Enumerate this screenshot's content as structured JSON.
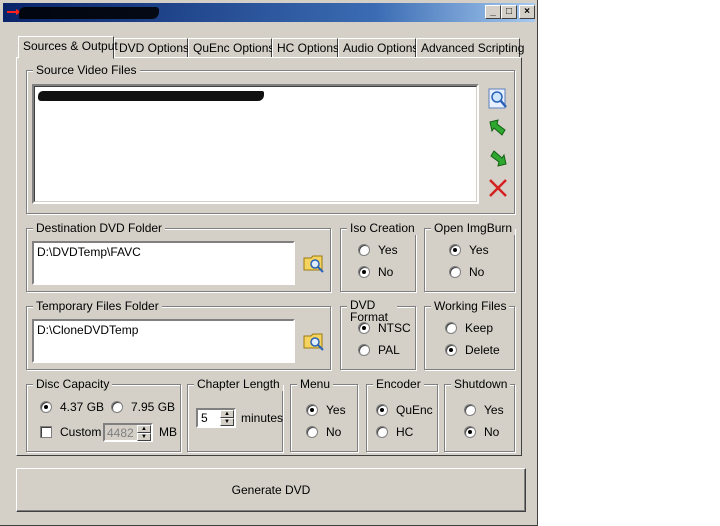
{
  "window": {
    "title": "",
    "controls": {
      "minimize": "_",
      "maximize": "□",
      "close": "×"
    }
  },
  "tabs": [
    {
      "label": "Sources & Output"
    },
    {
      "label": "DVD Options"
    },
    {
      "label": "QuEnc Options"
    },
    {
      "label": "HC Options"
    },
    {
      "label": "Audio Options"
    },
    {
      "label": "Advanced Scripting"
    }
  ],
  "source_video": {
    "legend": "Source Video Files",
    "icons": [
      "browse-icon",
      "move-up-icon",
      "move-down-icon",
      "remove-icon"
    ]
  },
  "destination": {
    "legend": "Destination DVD Folder",
    "value": "D:\\DVDTemp\\FAVC"
  },
  "iso_creation": {
    "legend": "Iso Creation",
    "yes": "Yes",
    "no": "No",
    "selected": "No"
  },
  "open_imgburn": {
    "legend": "Open ImgBurn",
    "yes": "Yes",
    "no": "No",
    "selected": "Yes"
  },
  "temp_folder": {
    "legend": "Temporary Files Folder",
    "value": "D:\\CloneDVDTemp"
  },
  "dvd_format": {
    "legend": "DVD Format",
    "ntsc": "NTSC",
    "pal": "PAL",
    "selected": "NTSC"
  },
  "working_files": {
    "legend": "Working Files",
    "keep": "Keep",
    "delete": "Delete",
    "selected": "Delete"
  },
  "disc_capacity": {
    "legend": "Disc Capacity",
    "opt1": "4.37 GB",
    "opt2": "7.95 GB",
    "selected": "4.37 GB",
    "custom_label": "Custom",
    "custom_value": "4482",
    "unit": "MB"
  },
  "chapter_length": {
    "legend": "Chapter Length",
    "value": "5",
    "unit": "minutes"
  },
  "menu": {
    "legend": "Menu",
    "yes": "Yes",
    "no": "No",
    "selected": "Yes"
  },
  "encoder": {
    "legend": "Encoder",
    "quenc": "QuEnc",
    "hc": "HC",
    "selected": "QuEnc"
  },
  "shutdown": {
    "legend": "Shutdown",
    "yes": "Yes",
    "no": "No",
    "selected": "No"
  },
  "generate_button": "Generate DVD",
  "colors": {
    "face": "#d4d0c8",
    "title_start": "#0a246a",
    "title_end": "#a6caf0"
  }
}
